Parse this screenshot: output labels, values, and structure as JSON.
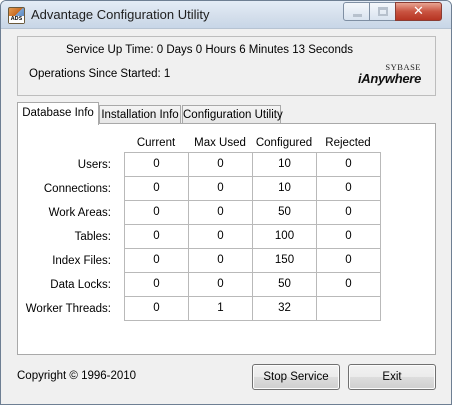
{
  "window": {
    "title": "Advantage Configuration Utility",
    "icon_text": "ADS",
    "close_glyph": "✕"
  },
  "status": {
    "uptime": "Service Up Time: 0 Days 0 Hours 6 Minutes 13 Seconds",
    "operations": "Operations Since Started: 1",
    "logo_top": "SYBASE",
    "logo_main": "iAnywhere"
  },
  "tabs": [
    {
      "label": "Database Info",
      "active": true
    },
    {
      "label": "Installation Info",
      "active": false
    },
    {
      "label": "Configuration Utility",
      "active": false
    }
  ],
  "table": {
    "columns": [
      "Current",
      "Max Used",
      "Configured",
      "Rejected"
    ],
    "rows": [
      {
        "label": "Users:",
        "values": [
          "0",
          "0",
          "10",
          "0"
        ]
      },
      {
        "label": "Connections:",
        "values": [
          "0",
          "0",
          "10",
          "0"
        ]
      },
      {
        "label": "Work Areas:",
        "values": [
          "0",
          "0",
          "50",
          "0"
        ]
      },
      {
        "label": "Tables:",
        "values": [
          "0",
          "0",
          "100",
          "0"
        ]
      },
      {
        "label": "Index Files:",
        "values": [
          "0",
          "0",
          "150",
          "0"
        ]
      },
      {
        "label": "Data Locks:",
        "values": [
          "0",
          "0",
          "50",
          "0"
        ]
      },
      {
        "label": "Worker Threads:",
        "values": [
          "0",
          "1",
          "32",
          ""
        ]
      }
    ]
  },
  "footer": {
    "copyright": "Copyright © 1996-2010",
    "stop_label": "Stop Service",
    "exit_label": "Exit"
  }
}
